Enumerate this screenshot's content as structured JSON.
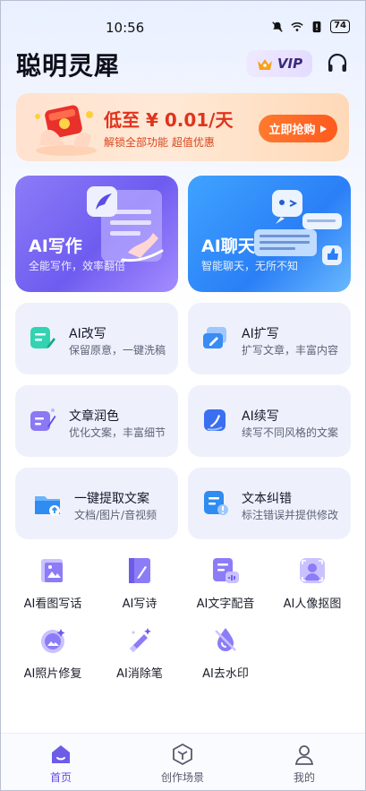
{
  "status_bar": {
    "time": "10:56",
    "battery": "74"
  },
  "header": {
    "app_title": "聪明灵犀",
    "vip_label": "VIP"
  },
  "banner": {
    "title": "低至 ¥ 0.01/天",
    "subtitle": "解锁全部功能  超值优惠",
    "button": "立即抢购"
  },
  "big_cards": [
    {
      "title": "AI写作",
      "subtitle": "全能写作，效率翻倍"
    },
    {
      "title": "AI聊天",
      "subtitle": "智能聊天，无所不知"
    }
  ],
  "features": [
    {
      "title": "AI改写",
      "subtitle": "保留原意，一键洗稿"
    },
    {
      "title": "AI扩写",
      "subtitle": "扩写文章，丰富内容"
    },
    {
      "title": "文章润色",
      "subtitle": "优化文案，丰富细节"
    },
    {
      "title": "AI续写",
      "subtitle": "续写不同风格的文案"
    },
    {
      "title": "一键提取文案",
      "subtitle": "文档/图片/音视频"
    },
    {
      "title": "文本纠错",
      "subtitle": "标注错误并提供修改"
    }
  ],
  "tools": [
    {
      "label": "AI看图写话"
    },
    {
      "label": "AI写诗"
    },
    {
      "label": "AI文字配音"
    },
    {
      "label": "AI人像抠图"
    },
    {
      "label": "AI照片修复"
    },
    {
      "label": "AI消除笔"
    },
    {
      "label": "AI去水印"
    }
  ],
  "nav": [
    {
      "label": "首页"
    },
    {
      "label": "创作场景"
    },
    {
      "label": "我的"
    }
  ],
  "colors": {
    "accent": "#5b4ce6",
    "banner_red": "#e0331c",
    "banner_button": "#ff6a25"
  }
}
